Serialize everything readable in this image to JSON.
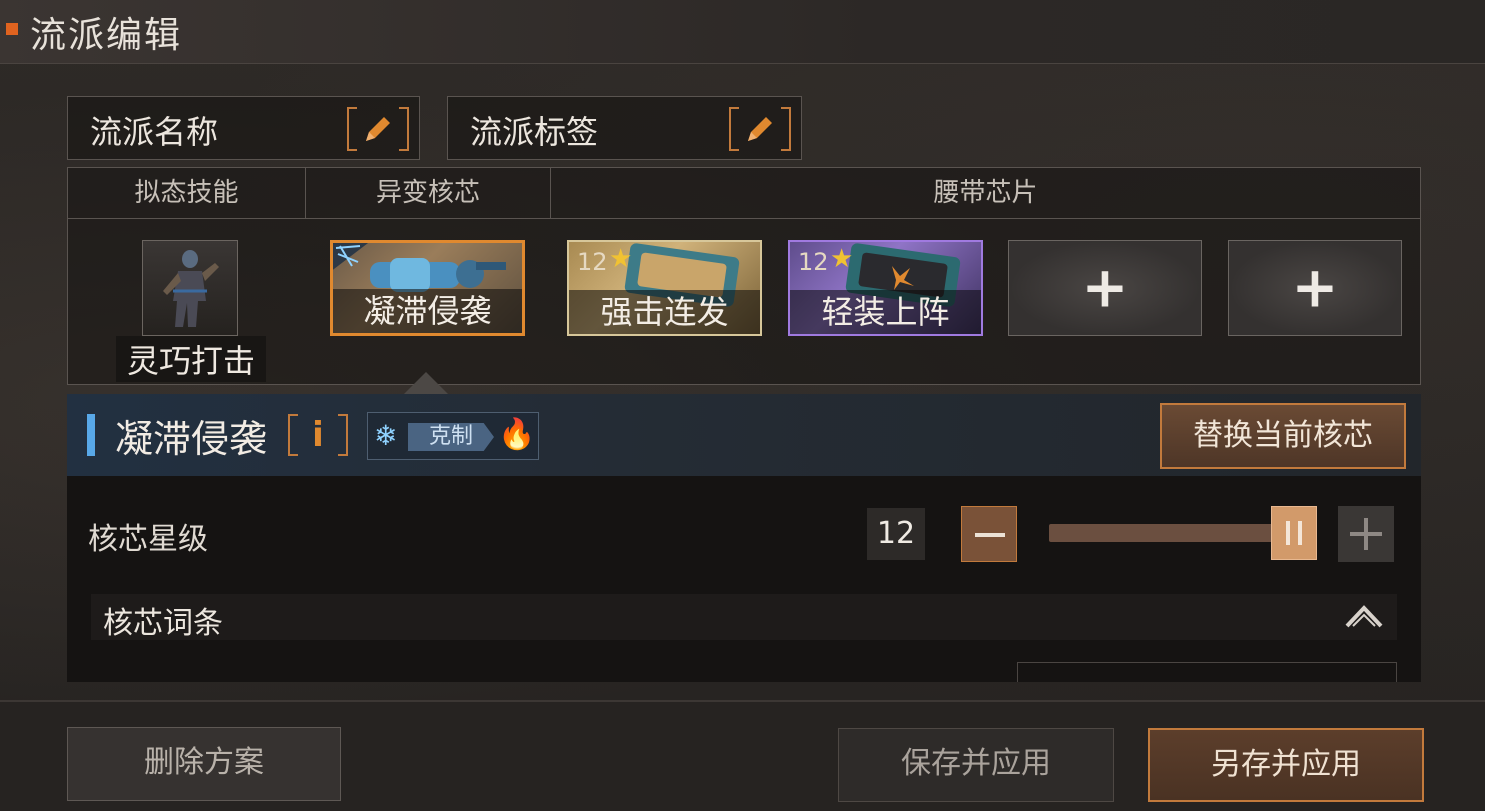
{
  "header": {
    "title": "流派编辑"
  },
  "name_fields": [
    {
      "label": "流派名称"
    },
    {
      "label": "流派标签"
    }
  ],
  "build_table": {
    "headers": [
      "拟态技能",
      "异变核芯",
      "腰带芯片"
    ],
    "skill": {
      "name": "灵巧打击"
    },
    "core": {
      "name": "凝滞侵袭"
    },
    "chips": [
      {
        "name": "强击连发",
        "level": "12"
      },
      {
        "name": "轻装上阵",
        "level": "12"
      }
    ],
    "empty_slot_icon": "plus-icon"
  },
  "core_detail": {
    "title": "凝滞侵袭",
    "info_label": "i",
    "counter": {
      "label": "克制",
      "from_icon": "snowflake-icon",
      "to_icon": "fire-icon"
    },
    "replace_button": "替换当前核芯",
    "star_level_label": "核芯星级",
    "star_level_value": "12",
    "slider_fraction": 1.0,
    "entries_section": "核芯词条"
  },
  "footer": {
    "delete_label": "删除方案",
    "save_label": "保存并应用",
    "save_as_label": "另存并应用"
  },
  "colors": {
    "accent_orange": "#c27a3c",
    "accent_blue": "#58a8e8",
    "chip_gold_border": "#d7c79a",
    "chip_purple_border": "#a07ae0"
  }
}
